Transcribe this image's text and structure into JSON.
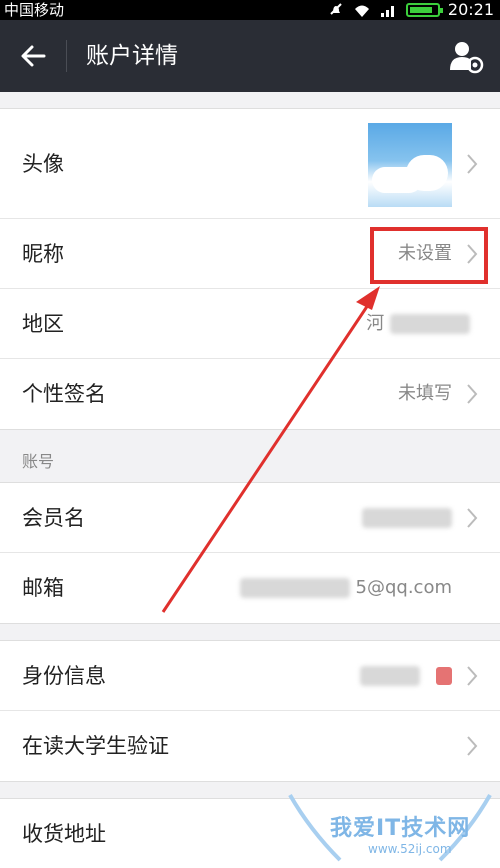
{
  "status_bar": {
    "carrier": "中国移动",
    "time": "20:21",
    "battery_level": 0.85
  },
  "nav": {
    "title": "账户详情",
    "back_icon": "back-arrow-icon",
    "right_icon": "user-settings-icon"
  },
  "profile": {
    "avatar_label": "头像",
    "nickname_label": "昵称",
    "nickname_value": "未设置",
    "region_label": "地区",
    "region_value": "河",
    "signature_label": "个性签名",
    "signature_value": "未填写"
  },
  "account": {
    "header": "账号",
    "member_label": "会员名",
    "email_label": "邮箱",
    "email_value": "5@qq.com"
  },
  "identity": {
    "id_label": "身份信息",
    "student_label": "在读大学生验证"
  },
  "shipping": {
    "address_label": "收货地址"
  },
  "watermark": {
    "text": "我爱IT技术网",
    "url": "www.52ij.com"
  },
  "colors": {
    "navbar": "#2a2d35",
    "highlight": "#e0302d",
    "battery": "#3ccf3c"
  }
}
